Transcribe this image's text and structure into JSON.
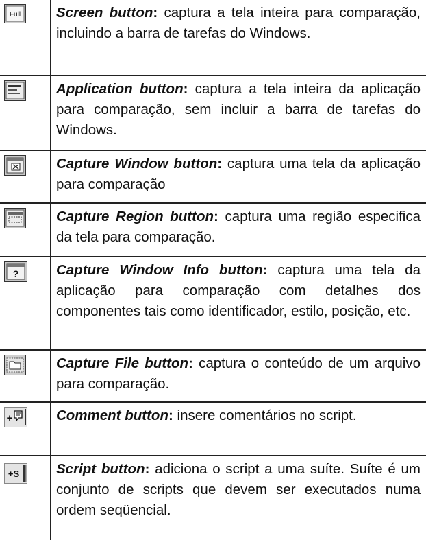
{
  "rows": [
    {
      "icon": "full-screen-icon",
      "icon_label": "Full",
      "name": "Screen button",
      "text": " captura a tela inteira para comparação, incluindo a barra de tarefas do Windows."
    },
    {
      "icon": "application-icon",
      "name": "Application button",
      "text": " captura a tela inteira da aplicação para comparação, sem incluir a barra de tarefas do Windows."
    },
    {
      "icon": "capture-window-icon",
      "name": "Capture Window button",
      "text": " captura uma tela da aplicação para comparação"
    },
    {
      "icon": "capture-region-icon",
      "name": "Capture Region button",
      "text": " captura uma região especifica da tela para comparação."
    },
    {
      "icon": "capture-window-info-icon",
      "icon_label": "?",
      "name": "Capture Window Info button",
      "text": " captura uma tela da aplicação para comparação com detalhes dos componentes tais como identificador, estilo, posição, etc."
    },
    {
      "icon": "capture-file-icon",
      "name": "Capture File button",
      "text": " captura o conteúdo de um arquivo para comparação."
    },
    {
      "icon": "comment-icon",
      "icon_label": "+",
      "name": "Comment button",
      "text": " insere comentários no script."
    },
    {
      "icon": "script-icon",
      "icon_label": "+S",
      "name": "Script button",
      "text": " adiciona o script a uma suíte. Suíte é um conjunto de scripts que devem ser executados numa ordem seqüencial."
    }
  ]
}
